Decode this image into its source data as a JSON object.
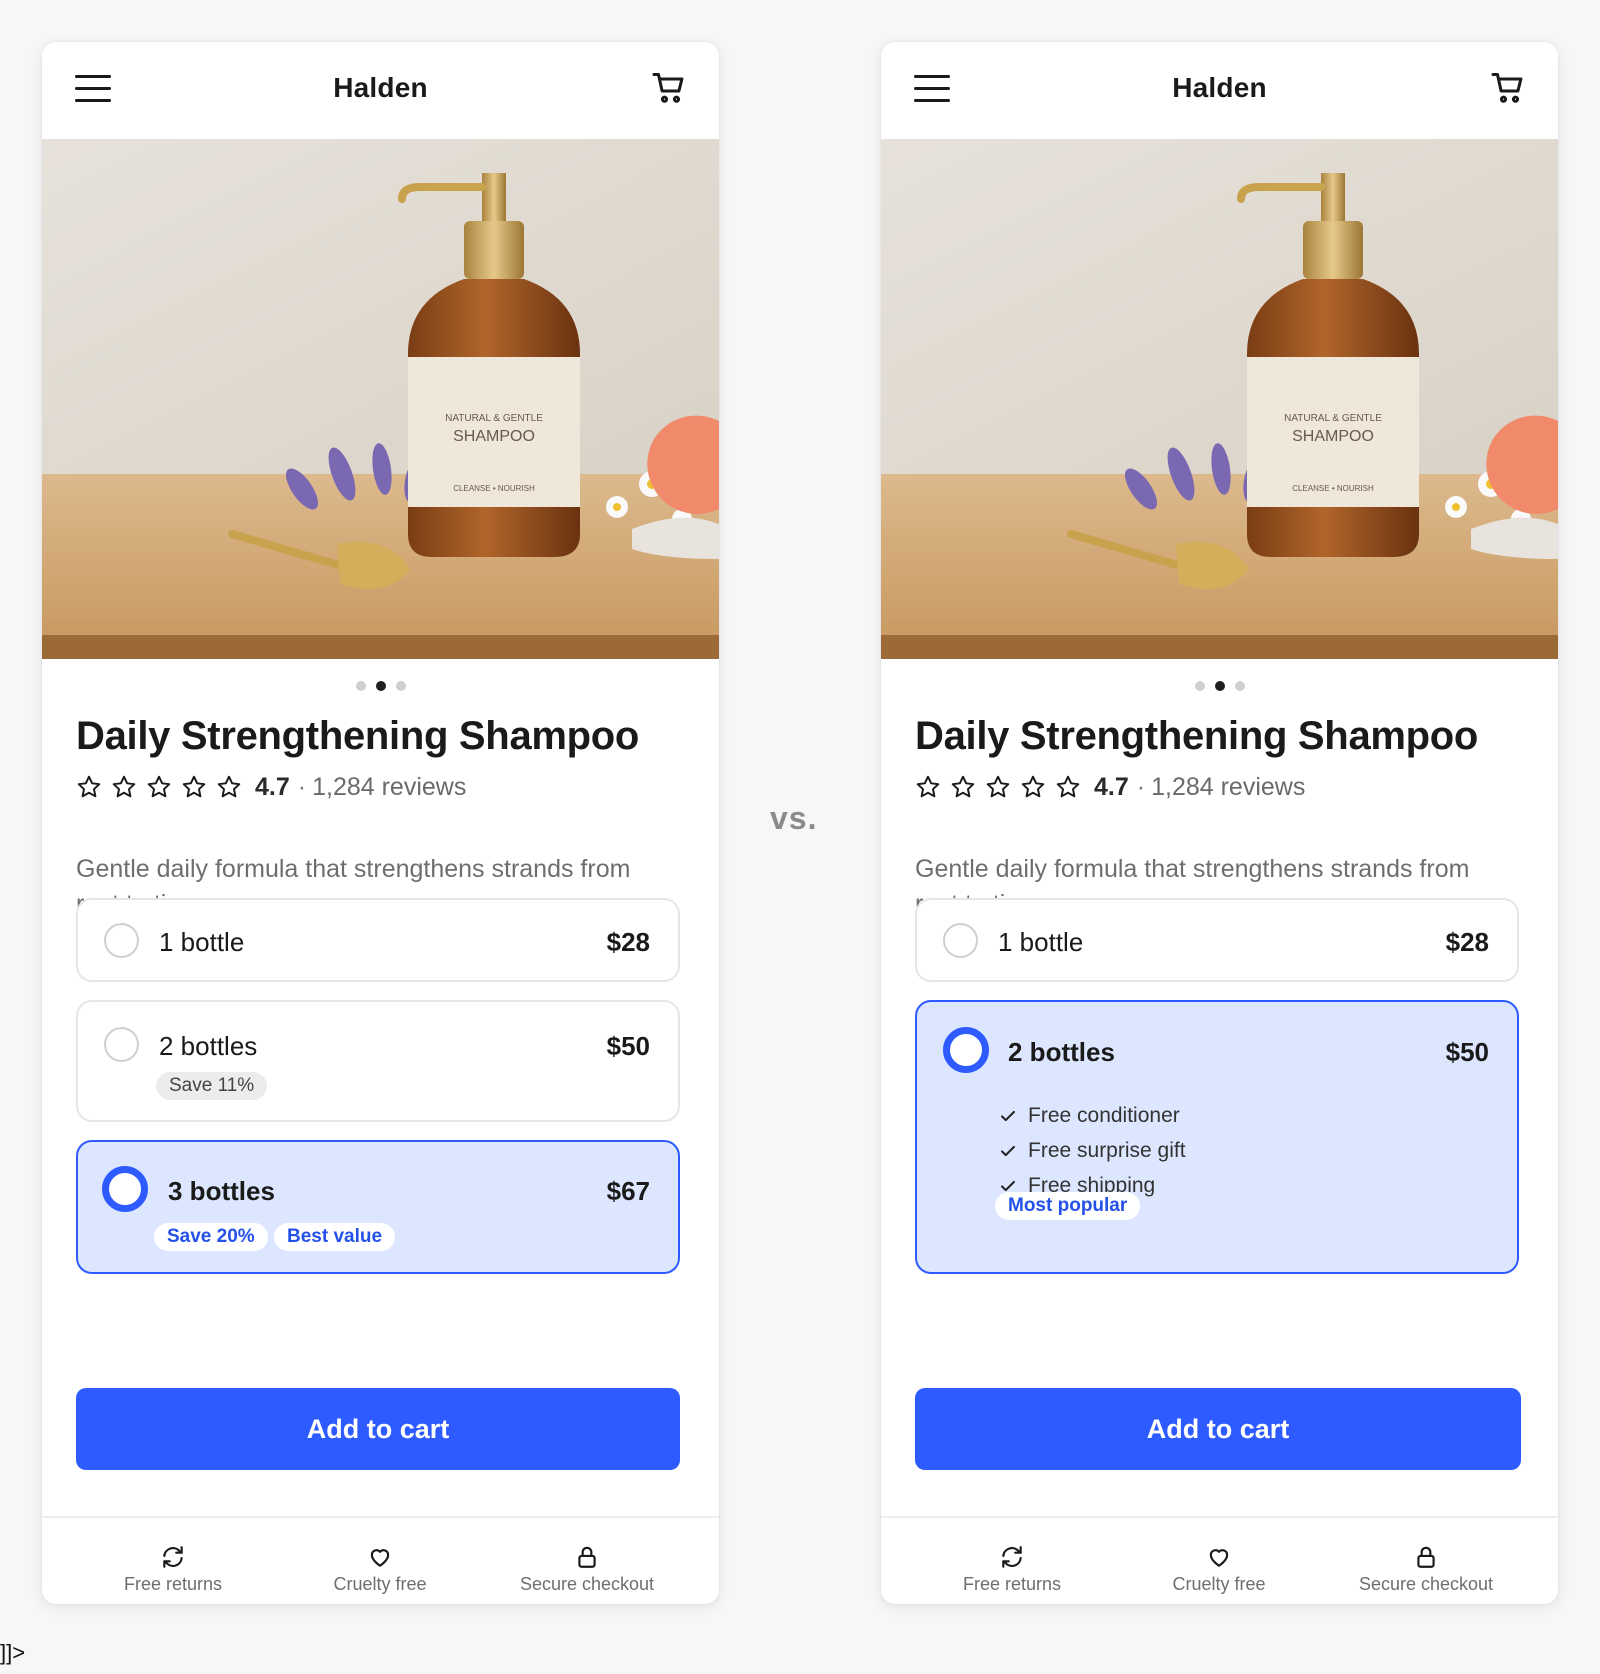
{
  "comparison_label": "vs.",
  "stray_text": "]]>",
  "variants": [
    {
      "header": {
        "brand": "Halden"
      },
      "product": {
        "title": "Daily Strengthening Shampoo",
        "rating_value": "4.7",
        "rating_separator": "·",
        "review_count": "1,284 reviews",
        "description": "Gentle daily formula that strengthens strands from root to tip.",
        "image_label": {
          "line1": "NATURAL & GENTLE",
          "line2": "SHAMPOO",
          "line3": "CLEANSE • NOURISH"
        }
      },
      "options": [
        {
          "label": "1 bottle",
          "price": "$28"
        },
        {
          "label": "2 bottles",
          "price": "$50",
          "tag": "Save 11%"
        },
        {
          "label": "3 bottles",
          "price": "$67",
          "tags": [
            "Save 20%",
            "Best value"
          ],
          "selected": true
        }
      ],
      "cta": "Add to cart",
      "features": [
        {
          "icon": "refresh-icon",
          "label": "Free returns"
        },
        {
          "icon": "heart-icon",
          "label": "Cruelty free"
        },
        {
          "icon": "lock-icon",
          "label": "Secure checkout"
        }
      ]
    },
    {
      "header": {
        "brand": "Halden"
      },
      "product": {
        "title": "Daily Strengthening Shampoo",
        "rating_value": "4.7",
        "rating_separator": "·",
        "review_count": "1,284 reviews",
        "description": "Gentle daily formula that strengthens strands from root to tip.",
        "image_label": {
          "line1": "NATURAL & GENTLE",
          "line2": "SHAMPOO",
          "line3": "CLEANSE • NOURISH"
        }
      },
      "options": [
        {
          "label": "1 bottle",
          "price": "$28"
        },
        {
          "label": "2 bottles",
          "price": "$50",
          "perks": [
            "Free conditioner",
            "Free surprise gift",
            "Free shipping"
          ],
          "tag": "Most popular",
          "selected": true
        }
      ],
      "cta": "Add to cart",
      "features": [
        {
          "icon": "refresh-icon",
          "label": "Free returns"
        },
        {
          "icon": "heart-icon",
          "label": "Cruelty free"
        },
        {
          "icon": "lock-icon",
          "label": "Secure checkout"
        }
      ]
    }
  ],
  "colors": {
    "accent": "#2e5bff",
    "selected_bg": "#dde6ff",
    "page_bg": "#f7f7f7"
  }
}
